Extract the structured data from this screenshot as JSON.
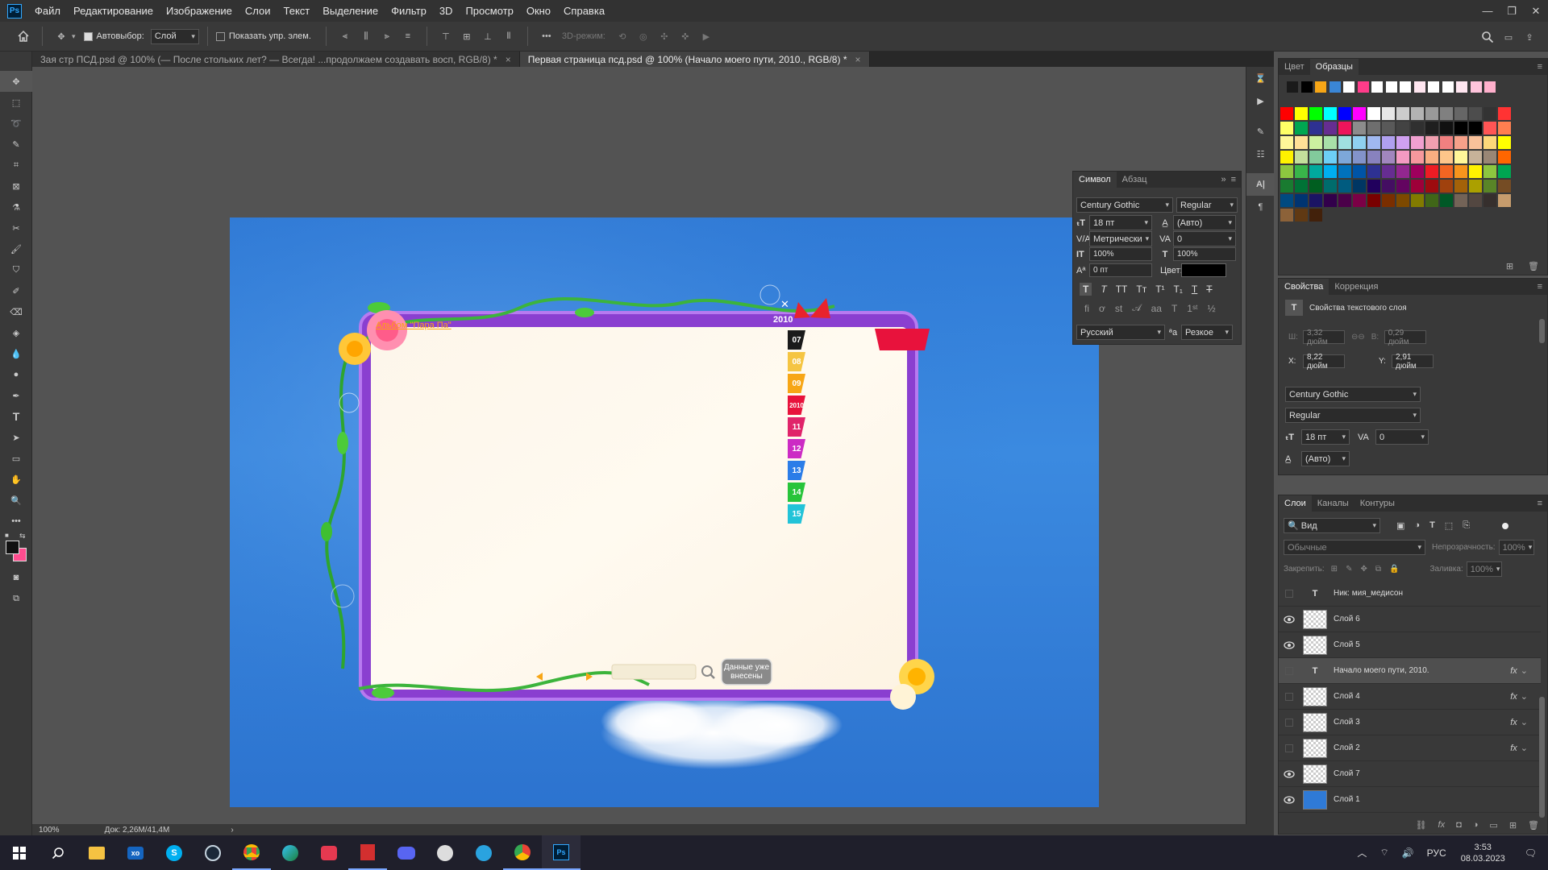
{
  "app": {
    "logo": "Ps"
  },
  "menu": [
    "Файл",
    "Редактирование",
    "Изображение",
    "Слои",
    "Текст",
    "Выделение",
    "Фильтр",
    "3D",
    "Просмотр",
    "Окно",
    "Справка"
  ],
  "options": {
    "autoselect_label": "Автовыбор:",
    "autoselect_value": "Слой",
    "show_transform_label": "Показать упр. элем.",
    "mode3d_label": "3D-режим:"
  },
  "tabs": [
    {
      "label": "3ая стр ПСД.psd @ 100% (— После стольких лет? — Всегда! ...продолжаем создавать восп, RGB/8) *"
    },
    {
      "label": "Первая страница псд.psd @ 100% (Начало моего пути, 2010., RGB/8) *"
    }
  ],
  "status": {
    "zoom": "100%",
    "doc": "Док: 2,26M/41,4M"
  },
  "artboard": {
    "album_title": "Альбом \"Пара Па\"",
    "tag_top": "2010",
    "year_tabs": [
      "07",
      "08",
      "09",
      "2010",
      "11",
      "12",
      "13",
      "14",
      "15"
    ],
    "data_button": "Данные уже внесены",
    "close": "✕"
  },
  "swatches_panel": {
    "tabs": [
      "Цвет",
      "Образцы"
    ],
    "recent": [
      "#1a1a1a",
      "#000000",
      "#f7a616",
      "#3a86d6",
      "#ffffff",
      "#ff3c8a",
      "#ffffff",
      "#ffffff",
      "#ffffff",
      "#ffe6f0",
      "#ffffff",
      "#ffffff",
      "#ffe6f0",
      "#ffc4dc",
      "#ffb0cc"
    ],
    "grid": [
      [
        "#ff0000",
        "#ffff00",
        "#00ff00",
        "#00ffff",
        "#0000ff",
        "#ff00ff",
        "#ffffff",
        "#e6e6e6",
        "#cccccc",
        "#b3b3b3",
        "#999999",
        "#808080",
        "#666666",
        "#4d4d4d",
        "#333333",
        "#ff3333"
      ],
      [
        "#ffff66",
        "#00a651",
        "#2e3192",
        "#662d91",
        "#ed145b",
        "#8c8c8c",
        "#6e6e6e",
        "#595959",
        "#434343",
        "#303030",
        "#1f1f1f",
        "#111111",
        "#000000",
        "#000000",
        "#ff5555",
        "#ff7f50"
      ],
      [
        "#fff799",
        "#ffe097",
        "#ccf0a0",
        "#a8e0a8",
        "#a0e0e0",
        "#8fd0f0",
        "#a0b8f0",
        "#b0a0f0",
        "#d0a0f0",
        "#f0a0d0",
        "#f0a0b0",
        "#f08080",
        "#f6a18a",
        "#f8c19a",
        "#fcd87a",
        "#ffff00"
      ],
      [
        "#fff200",
        "#c4df9b",
        "#82ca9c",
        "#6dcff6",
        "#7da7d9",
        "#8393ca",
        "#8882be",
        "#a186be",
        "#f49ac2",
        "#f6989d",
        "#f9ad81",
        "#fdc68a",
        "#fff799",
        "#c7b299",
        "#998675",
        "#ff6600"
      ],
      [
        "#8dc63f",
        "#39b54a",
        "#00a99d",
        "#00aeef",
        "#0072bc",
        "#0054a6",
        "#2e3192",
        "#662d91",
        "#92278f",
        "#9e005d",
        "#ed1c24",
        "#f26522",
        "#f7941d",
        "#fff200",
        "#8dc63f",
        "#00a651"
      ],
      [
        "#197b30",
        "#007236",
        "#005e20",
        "#006c6c",
        "#005b7f",
        "#003663",
        "#21005d",
        "#440e62",
        "#630460",
        "#9e0039",
        "#9e0b0f",
        "#a0410d",
        "#a36209",
        "#aba000",
        "#598527",
        "#754c24"
      ],
      [
        "#004a80",
        "#003471",
        "#1b1464",
        "#32004b",
        "#4b0049",
        "#7b0046",
        "#790000",
        "#7a2e00",
        "#7d4900",
        "#827b00",
        "#406618",
        "#005826",
        "#736357",
        "#534741",
        "#362f2d",
        "#c69c6d"
      ],
      [
        "#8c6239",
        "#603913",
        "#42210b"
      ]
    ]
  },
  "character": {
    "tabs": [
      "Символ",
      "Абзац"
    ],
    "font": "Century Gothic",
    "style": "Regular",
    "size": "18 пт",
    "leading": "(Авто)",
    "kerning": "Метрически",
    "tracking": "0",
    "vscale": "100%",
    "hscale": "100%",
    "baseline": "0 пт",
    "color_label": "Цвет:",
    "language": "Русский",
    "aa": "Резкое"
  },
  "properties": {
    "tabs": [
      "Свойства",
      "Коррекция"
    ],
    "title": "Свойства текстового слоя",
    "w_label": "Ш:",
    "w": "3,32 дюйм",
    "h_label": "В:",
    "h": "0,29 дюйм",
    "x_label": "X:",
    "x": "8,22 дюйм",
    "y_label": "Y:",
    "y": "2,91 дюйм",
    "font": "Century Gothic",
    "style": "Regular",
    "size": "18 пт",
    "tracking": "0",
    "leading": "(Авто)"
  },
  "layers_panel": {
    "tabs": [
      "Слои",
      "Каналы",
      "Контуры"
    ],
    "filter": "Вид",
    "blend": "Обычные",
    "opacity_label": "Непрозрачность:",
    "opacity": "100%",
    "lock_label": "Закрепить:",
    "fill_label": "Заливка:",
    "fill": "100%",
    "layers": [
      {
        "name": "Ник: мия_медисон",
        "type": "text",
        "visible": false,
        "fx": false
      },
      {
        "name": "Слой 6",
        "type": "pixel",
        "visible": true,
        "fx": false
      },
      {
        "name": "Слой 5",
        "type": "pixel",
        "visible": true,
        "fx": false
      },
      {
        "name": "Начало моего пути, 2010.",
        "type": "text",
        "visible": false,
        "fx": true,
        "selected": true
      },
      {
        "name": "Слой 4",
        "type": "pixel",
        "visible": false,
        "fx": true
      },
      {
        "name": "Слой 3",
        "type": "pixel",
        "visible": false,
        "fx": true
      },
      {
        "name": "Слой 2",
        "type": "pixel",
        "visible": false,
        "fx": true
      },
      {
        "name": "Слой 7",
        "type": "pixel",
        "visible": true,
        "fx": false
      },
      {
        "name": "Слой 1",
        "type": "pixel",
        "visible": true,
        "fx": false,
        "blue": true
      }
    ],
    "fx_label": "fx"
  },
  "taskbar": {
    "lang": "РУС",
    "time": "3:53",
    "date": "08.03.2023"
  }
}
